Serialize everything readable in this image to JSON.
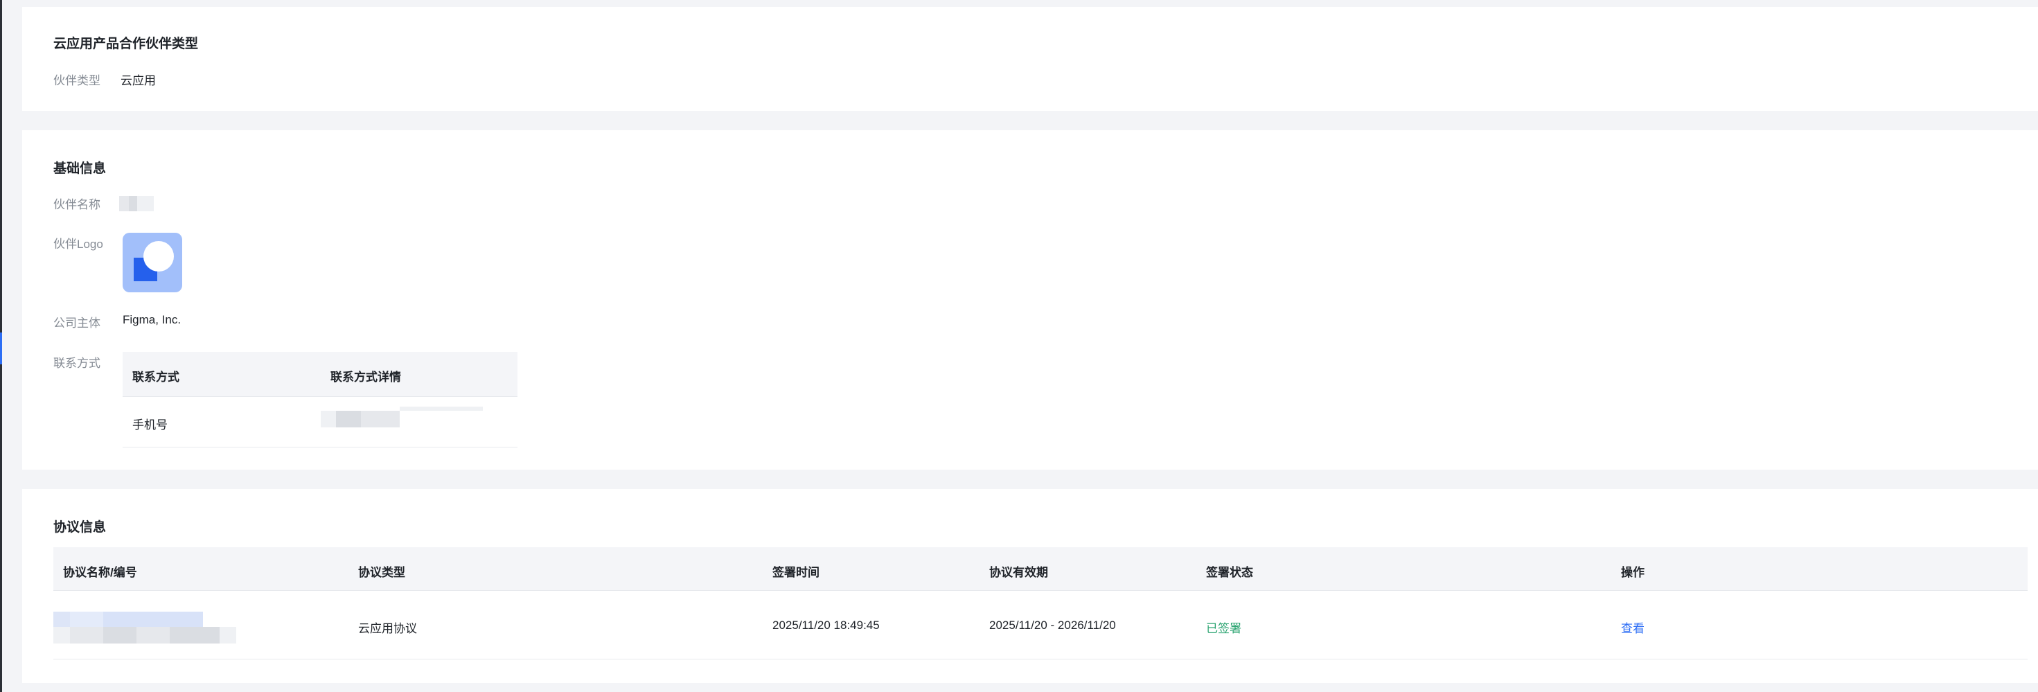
{
  "partner_type_section": {
    "title": "云应用产品合作伙伴类型",
    "label": "伙伴类型",
    "value": "云应用"
  },
  "basic_info": {
    "title": "基础信息",
    "name_label": "伙伴名称",
    "logo_label": "伙伴Logo",
    "company_label": "公司主体",
    "company_value": "Figma, Inc.",
    "contact_label": "联系方式",
    "contact_table": {
      "columns": [
        "联系方式",
        "联系方式详情"
      ],
      "rows": [
        {
          "type": "手机号"
        }
      ]
    }
  },
  "agreement_info": {
    "title": "协议信息",
    "columns": [
      "协议名称/编号",
      "协议类型",
      "签署时间",
      "协议有效期",
      "签署状态",
      "操作"
    ],
    "rows": [
      {
        "type": "云应用协议",
        "signed_at": "2025/11/20 18:49:45",
        "validity": "2025/11/20 - 2026/11/20",
        "status": "已签署",
        "action": "查看"
      }
    ]
  },
  "colors": {
    "accent": "#2d6ef5",
    "success": "#2ba471",
    "label": "#858b94",
    "page_bg": "#f3f4f7"
  }
}
